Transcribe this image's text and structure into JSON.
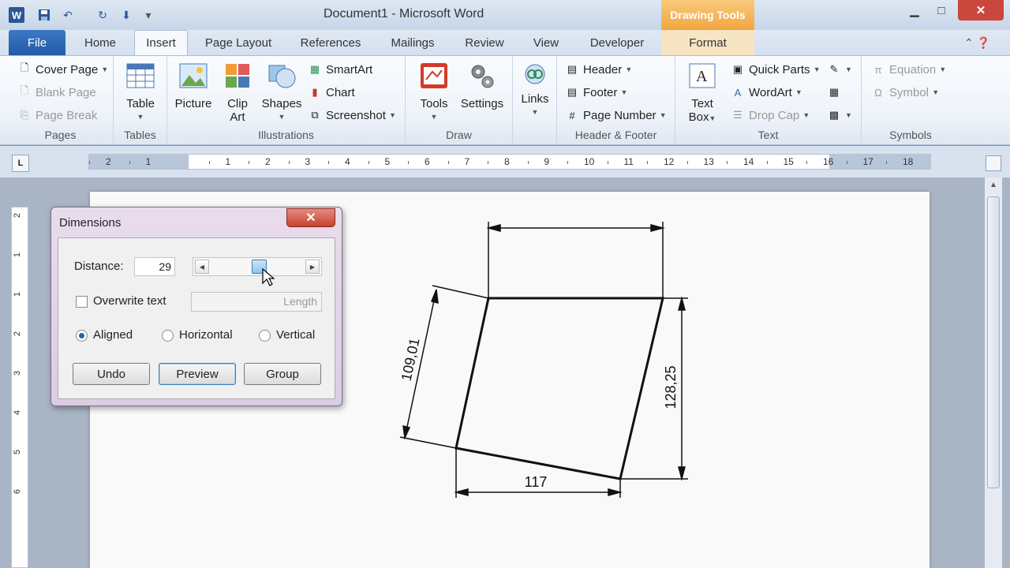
{
  "titlebar": {
    "title": "Document1  -  Microsoft Word",
    "context_tab": "Drawing Tools",
    "app_icon": "W"
  },
  "tabs": [
    "File",
    "Home",
    "Insert",
    "Page Layout",
    "References",
    "Mailings",
    "Review",
    "View",
    "Developer",
    "Format"
  ],
  "ribbon": {
    "pages": {
      "label": "Pages",
      "cover_page": "Cover Page",
      "blank_page": "Blank Page",
      "page_break": "Page Break"
    },
    "tables": {
      "label": "Tables",
      "table": "Table"
    },
    "illustrations": {
      "label": "Illustrations",
      "picture": "Picture",
      "clip_art_1": "Clip",
      "clip_art_2": "Art",
      "shapes": "Shapes",
      "smartart": "SmartArt",
      "chart": "Chart",
      "screenshot": "Screenshot"
    },
    "draw": {
      "label": "Draw",
      "tools": "Tools",
      "settings": "Settings"
    },
    "links": {
      "label": "Links"
    },
    "header_footer": {
      "label": "Header & Footer",
      "header": "Header",
      "footer": "Footer",
      "page_number": "Page Number"
    },
    "text": {
      "label": "Text",
      "text_box_1": "Text",
      "text_box_2": "Box",
      "quick_parts": "Quick Parts",
      "wordart": "WordArt",
      "drop_cap": "Drop Cap"
    },
    "symbols": {
      "label": "Symbols",
      "equation": "Equation",
      "symbol": "Symbol"
    }
  },
  "ruler": {
    "corner": "L",
    "ticks": [
      "2",
      "1",
      "1",
      "2",
      "3",
      "4",
      "5",
      "6",
      "7",
      "8",
      "9",
      "10",
      "11",
      "12",
      "13",
      "14",
      "15",
      "16",
      "17",
      "18"
    ]
  },
  "vruler": {
    "ticks": [
      "2",
      "1",
      "1",
      "2",
      "3",
      "4",
      "5",
      "6"
    ]
  },
  "drawing": {
    "dim_top": "",
    "dim_left": "109,01",
    "dim_right": "128,25",
    "dim_bottom": "117"
  },
  "dialog": {
    "title": "Dimensions",
    "close": "✕",
    "distance_label": "Distance:",
    "distance_value": "29",
    "slider_position": 0.5,
    "overwrite_label": "Overwrite text",
    "overwrite_checked": false,
    "length_placeholder": "Length",
    "radio_aligned": "Aligned",
    "radio_horizontal": "Horizontal",
    "radio_vertical": "Vertical",
    "selected_mode": "Aligned",
    "btn_undo": "Undo",
    "btn_preview": "Preview",
    "btn_group": "Group"
  },
  "colors": {
    "accent": "#2b5797",
    "context_tab": "#f2a640",
    "close": "#c9473d"
  }
}
